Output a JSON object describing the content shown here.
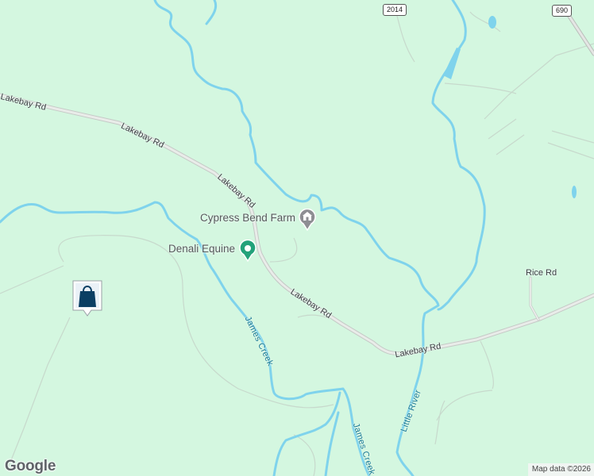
{
  "map": {
    "background_color": "#d4f7e0",
    "water_color": "#7fd3ec",
    "road_color": "#d9dcd9",
    "road_labels": [
      {
        "id": "lakebay-nw",
        "text": "Lakebay Rd"
      },
      {
        "id": "lakebay-mid",
        "text": "Lakebay Rd"
      },
      {
        "id": "lakebay-bend",
        "text": "Lakebay Rd"
      },
      {
        "id": "lakebay-south",
        "text": "Lakebay Rd"
      },
      {
        "id": "lakebay-east",
        "text": "Lakebay Rd"
      },
      {
        "id": "rice",
        "text": "Rice Rd"
      }
    ],
    "water_labels": [
      {
        "id": "james-creek-1",
        "text": "James Creek"
      },
      {
        "id": "james-creek-2",
        "text": "James Creek"
      },
      {
        "id": "little-river",
        "text": "Little River"
      }
    ],
    "route_shields": [
      {
        "id": "route-2014",
        "text": "2014"
      },
      {
        "id": "route-690",
        "text": "690"
      }
    ],
    "pois": [
      {
        "id": "cypress-bend-farm",
        "name": "Cypress Bend Farm",
        "icon": "farm-icon",
        "pin_color": "#8e8e93"
      },
      {
        "id": "denali-equine",
        "name": "Denali Equine",
        "icon": "equine-icon",
        "pin_color": "#23a27a"
      }
    ],
    "listing_marker": {
      "icon": "shopping-bag-icon",
      "color": "#0b3f63"
    },
    "branding": {
      "logo_text": "Google"
    },
    "attribution": "Map data ©2026"
  }
}
